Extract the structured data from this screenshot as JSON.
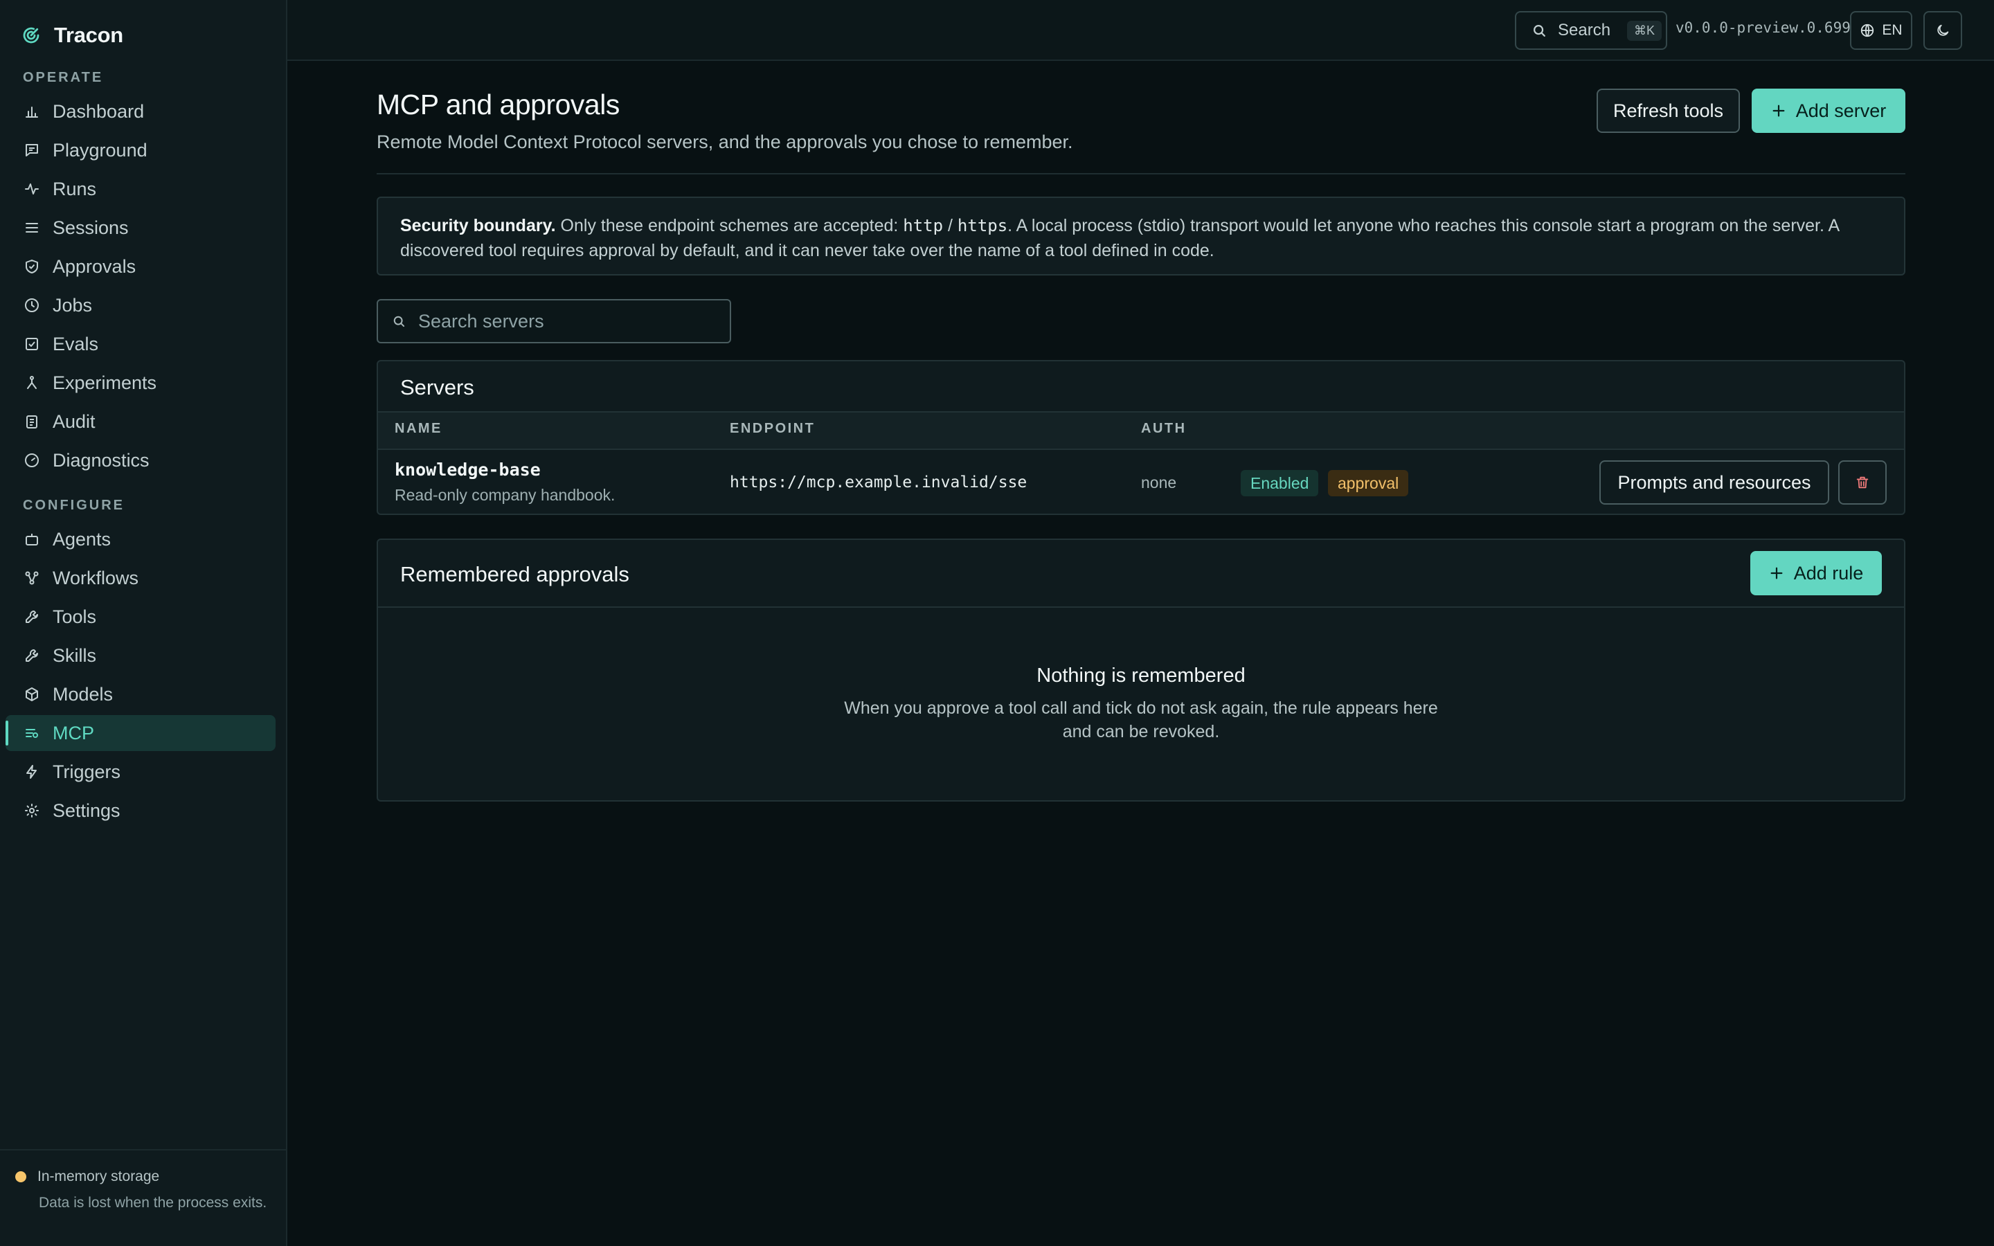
{
  "app": {
    "name": "Tracon",
    "accent": "#5fd9c2"
  },
  "sidebar": {
    "sections": {
      "operate": "OPERATE",
      "configure": "CONFIGURE"
    },
    "operate": [
      {
        "label": "Dashboard",
        "icon": "bar-chart-icon"
      },
      {
        "label": "Playground",
        "icon": "message-icon"
      },
      {
        "label": "Runs",
        "icon": "activity-icon"
      },
      {
        "label": "Sessions",
        "icon": "list-icon"
      },
      {
        "label": "Approvals",
        "icon": "shield-check-icon"
      },
      {
        "label": "Jobs",
        "icon": "clock-icon"
      },
      {
        "label": "Evals",
        "icon": "checkbox-icon"
      },
      {
        "label": "Experiments",
        "icon": "branch-icon"
      },
      {
        "label": "Audit",
        "icon": "clipboard-icon"
      },
      {
        "label": "Diagnostics",
        "icon": "gauge-icon"
      }
    ],
    "configure": [
      {
        "label": "Agents",
        "icon": "bot-icon"
      },
      {
        "label": "Workflows",
        "icon": "workflow-icon"
      },
      {
        "label": "Tools",
        "icon": "wrench-icon"
      },
      {
        "label": "Skills",
        "icon": "wrench-icon"
      },
      {
        "label": "Models",
        "icon": "cube-icon"
      },
      {
        "label": "MCP",
        "icon": "mcp-icon",
        "active": true
      },
      {
        "label": "Triggers",
        "icon": "zap-icon"
      },
      {
        "label": "Settings",
        "icon": "sun-icon"
      }
    ],
    "footer": {
      "title": "In-memory storage",
      "description": "Data is lost when the process exits.",
      "status_color": "#f6c56b"
    }
  },
  "topbar": {
    "search_label": "Search",
    "search_shortcut": "⌘K",
    "version": "v0.0.0-preview.0.699",
    "language": "EN"
  },
  "page": {
    "title": "MCP and approvals",
    "subtitle": "Remote Model Context Protocol servers, and the approvals you chose to remember.",
    "refresh_label": "Refresh tools",
    "add_server_label": "Add server"
  },
  "notice": {
    "lead": "Security boundary.",
    "text_1": " Only these endpoint schemes are accepted: ",
    "scheme_http": "http",
    "separator": " / ",
    "scheme_https": "https",
    "text_2": ". A local process (stdio) transport would let anyone who reaches this console start a program on the server. A discovered tool requires approval by default, and it can never take over the name of a tool defined in code."
  },
  "server_search": {
    "placeholder": "Search servers"
  },
  "servers": {
    "title": "Servers",
    "columns": {
      "name": "NAME",
      "endpoint": "ENDPOINT",
      "auth": "AUTH"
    },
    "rows": [
      {
        "name": "knowledge-base",
        "description": "Read-only company handbook.",
        "endpoint": "https://mcp.example.invalid/sse",
        "auth": "none",
        "status": "Enabled",
        "policy": "approval",
        "action_label": "Prompts and resources"
      }
    ]
  },
  "approvals": {
    "title": "Remembered approvals",
    "add_rule_label": "Add rule",
    "empty_title": "Nothing is remembered",
    "empty_description": "When you approve a tool call and tick do not ask again, the rule appears here and can be revoked."
  }
}
